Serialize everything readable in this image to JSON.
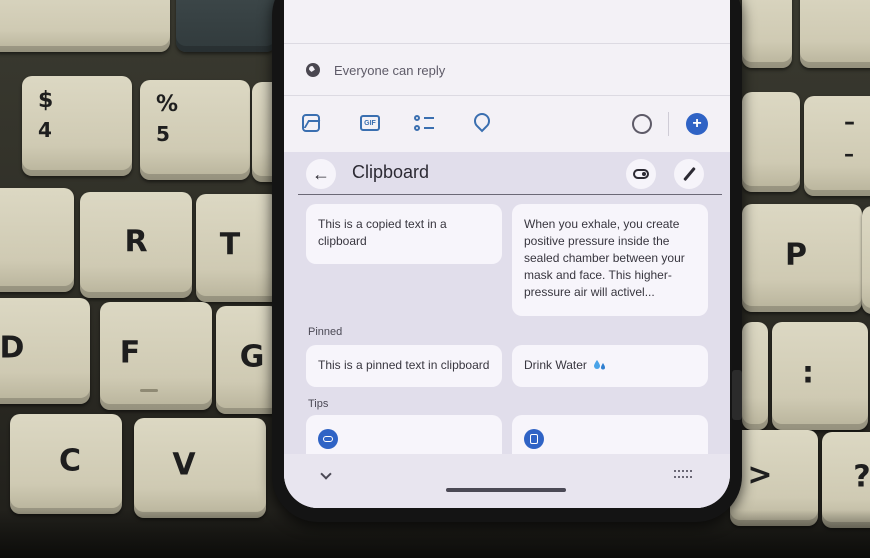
{
  "compose": {
    "reply_setting": "Everyone can reply",
    "toolbar": {
      "gif_label": "GIF",
      "add_label": "+"
    }
  },
  "clipboard": {
    "title": "Clipboard",
    "back_glyph": "←",
    "items": [
      "This is a copied text in a clipboard",
      "When you exhale, you create positive pressure inside the sealed chamber between your mask and face. This higher-pressure air will activel..."
    ],
    "pinned_label": "Pinned",
    "pinned": [
      "This is a pinned text in clipboard",
      "Drink Water"
    ],
    "tips_label": "Tips"
  },
  "keyboard_keys": {
    "k1_top": "$",
    "k1_bot": "4",
    "k2_top": "%",
    "k2_bot": "5",
    "r": "R",
    "t": "T",
    "p": "P",
    "d": "D",
    "f": "F",
    "g": "G",
    "c": "C",
    "v": "V",
    "minus": "–",
    "colon": ":",
    "gt": ">",
    "qmark": "?"
  },
  "colors": {
    "accent": "#2f63c5",
    "panel_bg": "#e1deeb",
    "card_bg": "#f7f5fb"
  }
}
